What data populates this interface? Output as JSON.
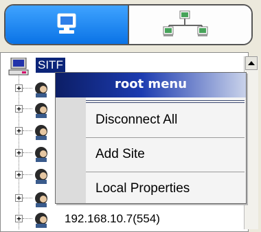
{
  "tabs": {
    "local_tab_icon": "monitor-icon",
    "network_tab_icon": "network-icon",
    "active_color": "#1a86f5"
  },
  "tree": {
    "site_label": "SITF",
    "site_icon": "computer-icon",
    "host_icon": "user-head-icon",
    "visible_host_label": "192.168.10.7(554)"
  },
  "context_menu": {
    "title": "root menu",
    "items": [
      {
        "label": "Disconnect All"
      },
      {
        "label": "Add Site"
      },
      {
        "label": "Local Properties"
      }
    ]
  }
}
